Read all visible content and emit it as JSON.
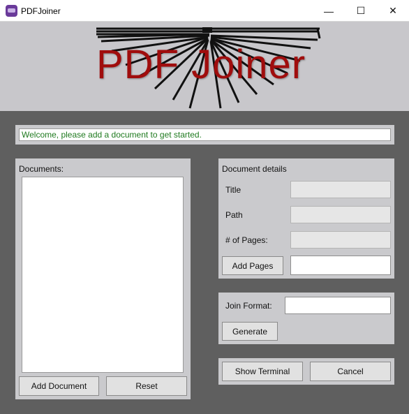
{
  "window": {
    "title": "PDFJoiner",
    "controls": {
      "minimize": "—",
      "maximize": "☐",
      "close": "✕"
    }
  },
  "banner": {
    "logo_text": "PDF Joiner",
    "logo_color": "#a00d0d"
  },
  "status": {
    "message": "Welcome, please add a document to get started.",
    "color": "#1f7a1f"
  },
  "documents": {
    "label": "Documents:",
    "items": [],
    "add_button": "Add Document",
    "reset_button": "Reset"
  },
  "details": {
    "heading": "Document details",
    "title_label": "Title",
    "title_value": "",
    "path_label": "Path",
    "path_value": "",
    "pages_label": "# of Pages:",
    "pages_value": "",
    "add_pages_button": "Add Pages",
    "add_pages_value": ""
  },
  "join": {
    "format_label": "Join Format:",
    "format_value": "",
    "generate_button": "Generate"
  },
  "actions": {
    "show_terminal_button": "Show Terminal",
    "cancel_button": "Cancel"
  }
}
